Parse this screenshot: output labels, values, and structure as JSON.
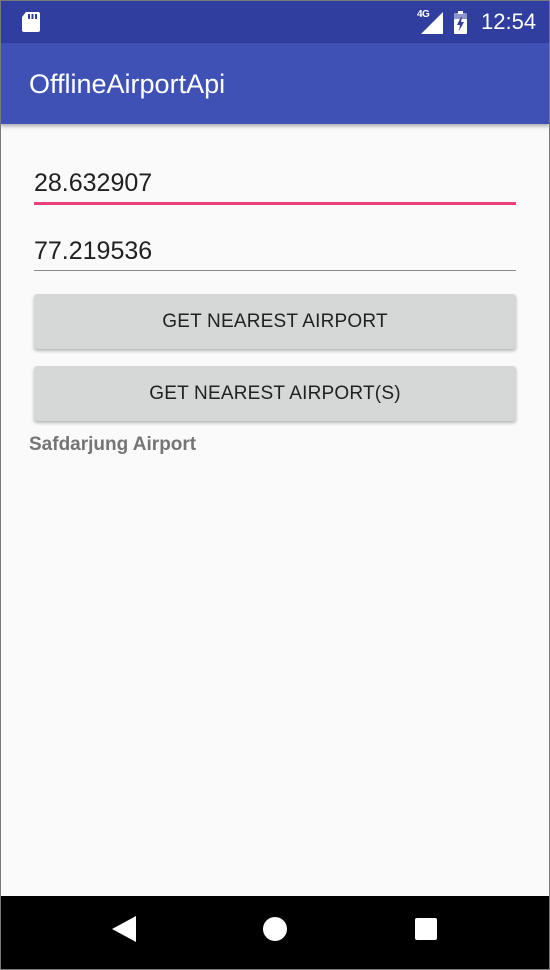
{
  "status_bar": {
    "network_type": "4G",
    "time": "12:54",
    "icons": [
      "sd-card-icon",
      "signal-icon",
      "battery-icon"
    ]
  },
  "app_bar": {
    "title": "OfflineAirportApi"
  },
  "form": {
    "latitude_value": "28.632907",
    "longitude_value": "77.219536"
  },
  "buttons": {
    "nearest_label": "GET NEAREST AIRPORT",
    "nearest_multi_label": "GET NEAREST AIRPORT(S)"
  },
  "result": {
    "text": "Safdarjung Airport"
  },
  "nav_bar": {
    "icons": [
      "back-icon",
      "home-icon",
      "recents-icon"
    ]
  },
  "colors": {
    "status_bar": "#303f9f",
    "app_bar": "#3f51b5",
    "accent": "#ec407a",
    "button": "#d6d7d7",
    "background": "#fafafa"
  }
}
